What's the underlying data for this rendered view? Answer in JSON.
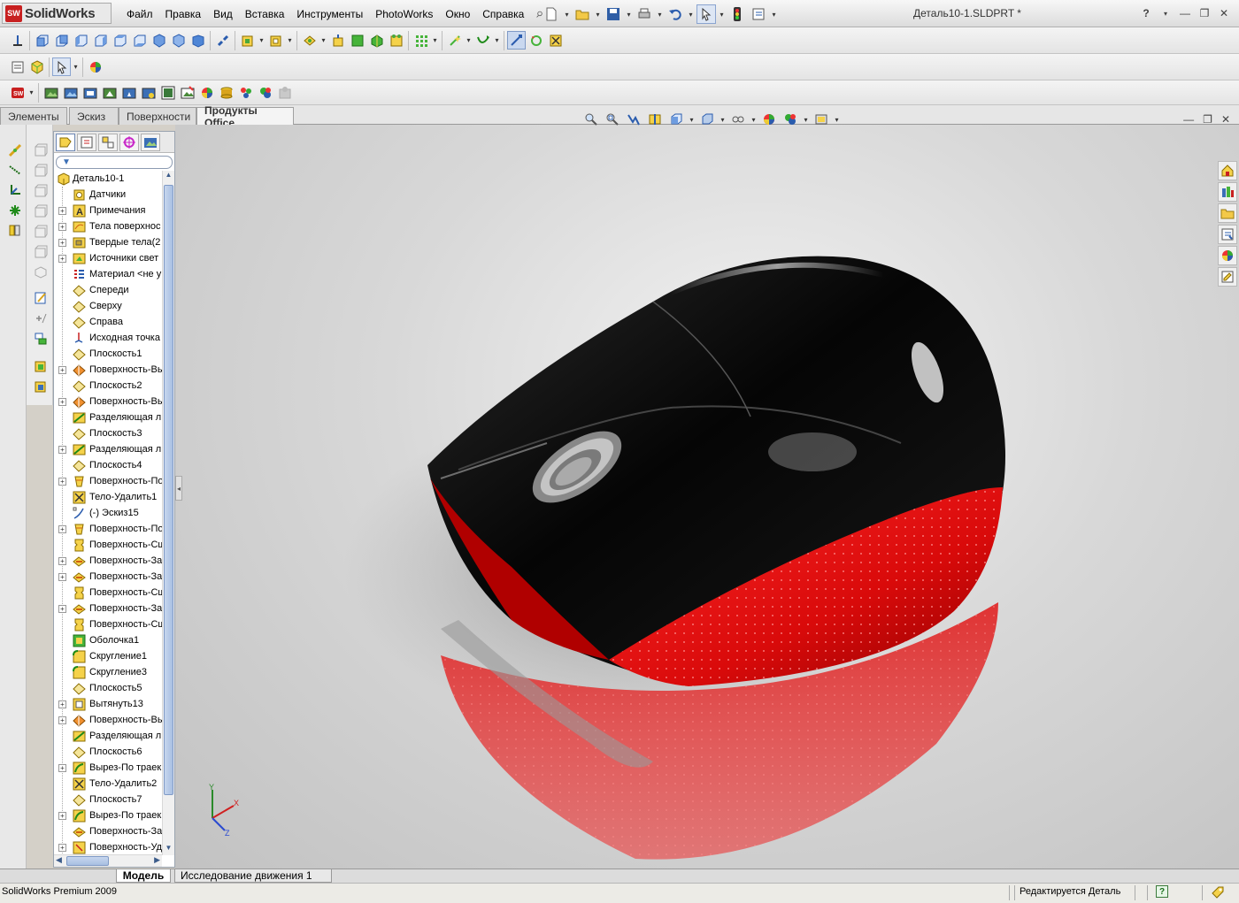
{
  "app": {
    "logo_text": "SolidWorks",
    "logo_badge": "SW",
    "doc_title": "Деталь10-1.SLDPRT *",
    "help": "?"
  },
  "menu": [
    "Файл",
    "Правка",
    "Вид",
    "Вставка",
    "Инструменты",
    "PhotoWorks",
    "Окно",
    "Справка"
  ],
  "command_tabs": [
    {
      "label": "Элементы",
      "active": false
    },
    {
      "label": "Эскиз",
      "active": false
    },
    {
      "label": "Поверхности",
      "active": false
    },
    {
      "label": "Продукты Office",
      "active": true
    }
  ],
  "feature_tree": {
    "root": "Деталь10-1",
    "nodes": [
      {
        "label": "Датчики",
        "exp": false,
        "icon": "sensor-icon"
      },
      {
        "label": "Примечания",
        "exp": true,
        "icon": "annotation-icon"
      },
      {
        "label": "Тела поверхнос",
        "exp": true,
        "icon": "surface-bodies-icon"
      },
      {
        "label": "Твердые тела(2",
        "exp": true,
        "icon": "solid-bodies-icon"
      },
      {
        "label": "Источники свет",
        "exp": true,
        "icon": "lights-icon"
      },
      {
        "label": "Материал <не у",
        "exp": false,
        "icon": "material-icon"
      },
      {
        "label": "Спереди",
        "exp": false,
        "icon": "plane-icon"
      },
      {
        "label": "Сверху",
        "exp": false,
        "icon": "plane-icon"
      },
      {
        "label": "Справа",
        "exp": false,
        "icon": "plane-icon"
      },
      {
        "label": "Исходная точка",
        "exp": false,
        "icon": "origin-icon"
      },
      {
        "label": "Плоскость1",
        "exp": false,
        "icon": "plane-icon"
      },
      {
        "label": "Поверхность-Вы",
        "exp": true,
        "icon": "extruded-surface-icon"
      },
      {
        "label": "Плоскость2",
        "exp": false,
        "icon": "plane-icon"
      },
      {
        "label": "Поверхность-Вы",
        "exp": true,
        "icon": "extruded-surface-icon"
      },
      {
        "label": "Разделяющая л",
        "exp": false,
        "icon": "split-line-icon"
      },
      {
        "label": "Плоскость3",
        "exp": false,
        "icon": "plane-icon"
      },
      {
        "label": "Разделяющая л",
        "exp": true,
        "icon": "split-line-icon"
      },
      {
        "label": "Плоскость4",
        "exp": false,
        "icon": "plane-icon"
      },
      {
        "label": "Поверхность-По",
        "exp": true,
        "icon": "boundary-surface-icon"
      },
      {
        "label": "Тело-Удалить1",
        "exp": false,
        "icon": "delete-body-icon"
      },
      {
        "label": "(-) Эскиз15",
        "exp": false,
        "icon": "sketch-icon"
      },
      {
        "label": "Поверхность-По",
        "exp": true,
        "icon": "boundary-surface-icon"
      },
      {
        "label": "Поверхность-Сш",
        "exp": false,
        "icon": "knit-surface-icon"
      },
      {
        "label": "Поверхность-За",
        "exp": true,
        "icon": "fill-surface-icon"
      },
      {
        "label": "Поверхность-За",
        "exp": true,
        "icon": "fill-surface-icon"
      },
      {
        "label": "Поверхность-Сш",
        "exp": false,
        "icon": "knit-surface-icon"
      },
      {
        "label": "Поверхность-За",
        "exp": true,
        "icon": "fill-surface-icon"
      },
      {
        "label": "Поверхность-Сш",
        "exp": false,
        "icon": "knit-surface-icon"
      },
      {
        "label": "Оболочка1",
        "exp": false,
        "icon": "shell-icon"
      },
      {
        "label": "Скругление1",
        "exp": false,
        "icon": "fillet-icon"
      },
      {
        "label": "Скругление3",
        "exp": false,
        "icon": "fillet-icon"
      },
      {
        "label": "Плоскость5",
        "exp": false,
        "icon": "plane-icon"
      },
      {
        "label": "Вытянуть13",
        "exp": true,
        "icon": "extrude-icon"
      },
      {
        "label": "Поверхность-Вы",
        "exp": true,
        "icon": "extruded-surface-icon"
      },
      {
        "label": "Разделяющая л",
        "exp": false,
        "icon": "split-line-icon"
      },
      {
        "label": "Плоскость6",
        "exp": false,
        "icon": "plane-icon"
      },
      {
        "label": "Вырез-По траек",
        "exp": true,
        "icon": "sweep-cut-icon"
      },
      {
        "label": "Тело-Удалить2",
        "exp": false,
        "icon": "delete-body-icon"
      },
      {
        "label": "Плоскость7",
        "exp": false,
        "icon": "plane-icon"
      },
      {
        "label": "Вырез-По траек",
        "exp": true,
        "icon": "sweep-cut-icon"
      },
      {
        "label": "Поверхность-За",
        "exp": false,
        "icon": "fill-surface-icon"
      },
      {
        "label": "Поверхность-Уд",
        "exp": true,
        "icon": "delete-face-icon"
      }
    ]
  },
  "bottom_tabs": [
    {
      "label": "Модель",
      "active": true
    },
    {
      "label": "Исследование движения 1",
      "active": false
    }
  ],
  "status": {
    "left": "SolidWorks Premium 2009",
    "right": "Редактируется Деталь",
    "help_badge": "?"
  },
  "triad": {
    "x": "X",
    "y": "Y",
    "z": "Z"
  },
  "colors": {
    "mouse_body": "#0a0a0a",
    "mouse_grip": "#e41010",
    "viewport_bg": "#d2d2d2",
    "accent": "#c82020"
  }
}
